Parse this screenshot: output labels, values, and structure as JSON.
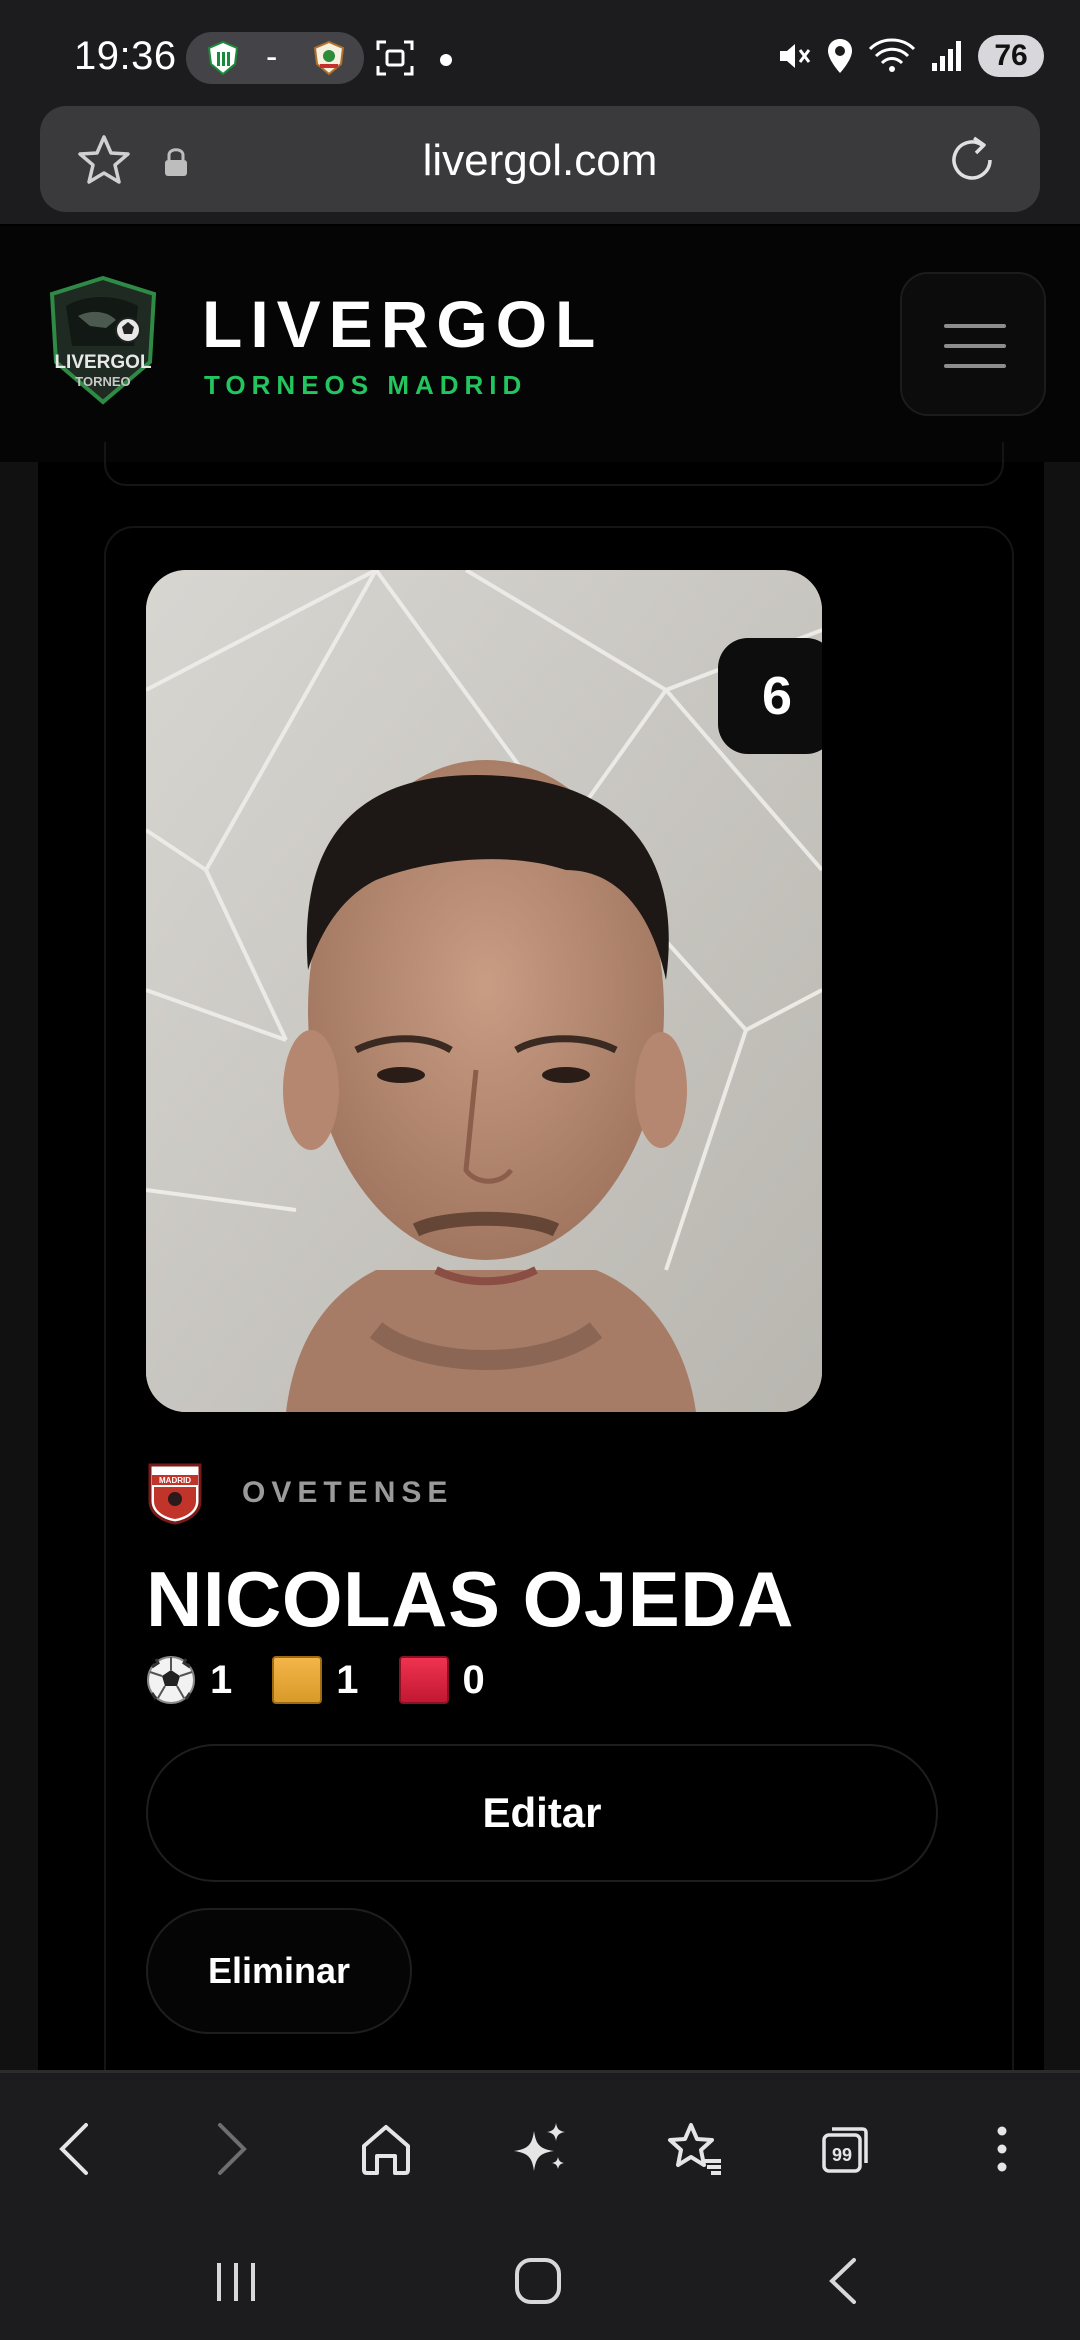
{
  "status_bar": {
    "time": "19:36",
    "match_separator": "-",
    "battery": "76"
  },
  "browser": {
    "url": "livergol.com"
  },
  "site": {
    "brand_title": "LIVERGOL",
    "brand_subtitle": "TORNEOS MADRID",
    "logo_text_1": "LIVERGOL",
    "logo_text_2": "TORNEO"
  },
  "player": {
    "number": "6",
    "team": "OVETENSE",
    "team_crest_text": "MADRID",
    "name": "NICOLAS OJEDA",
    "goals": "1",
    "yellow_cards": "1",
    "red_cards": "0"
  },
  "actions": {
    "edit_label": "Editar",
    "delete_label": "Eliminar"
  },
  "colors": {
    "accent_green": "#22c55e",
    "yellow_card": "#f3b548",
    "red_card": "#ef3350"
  }
}
